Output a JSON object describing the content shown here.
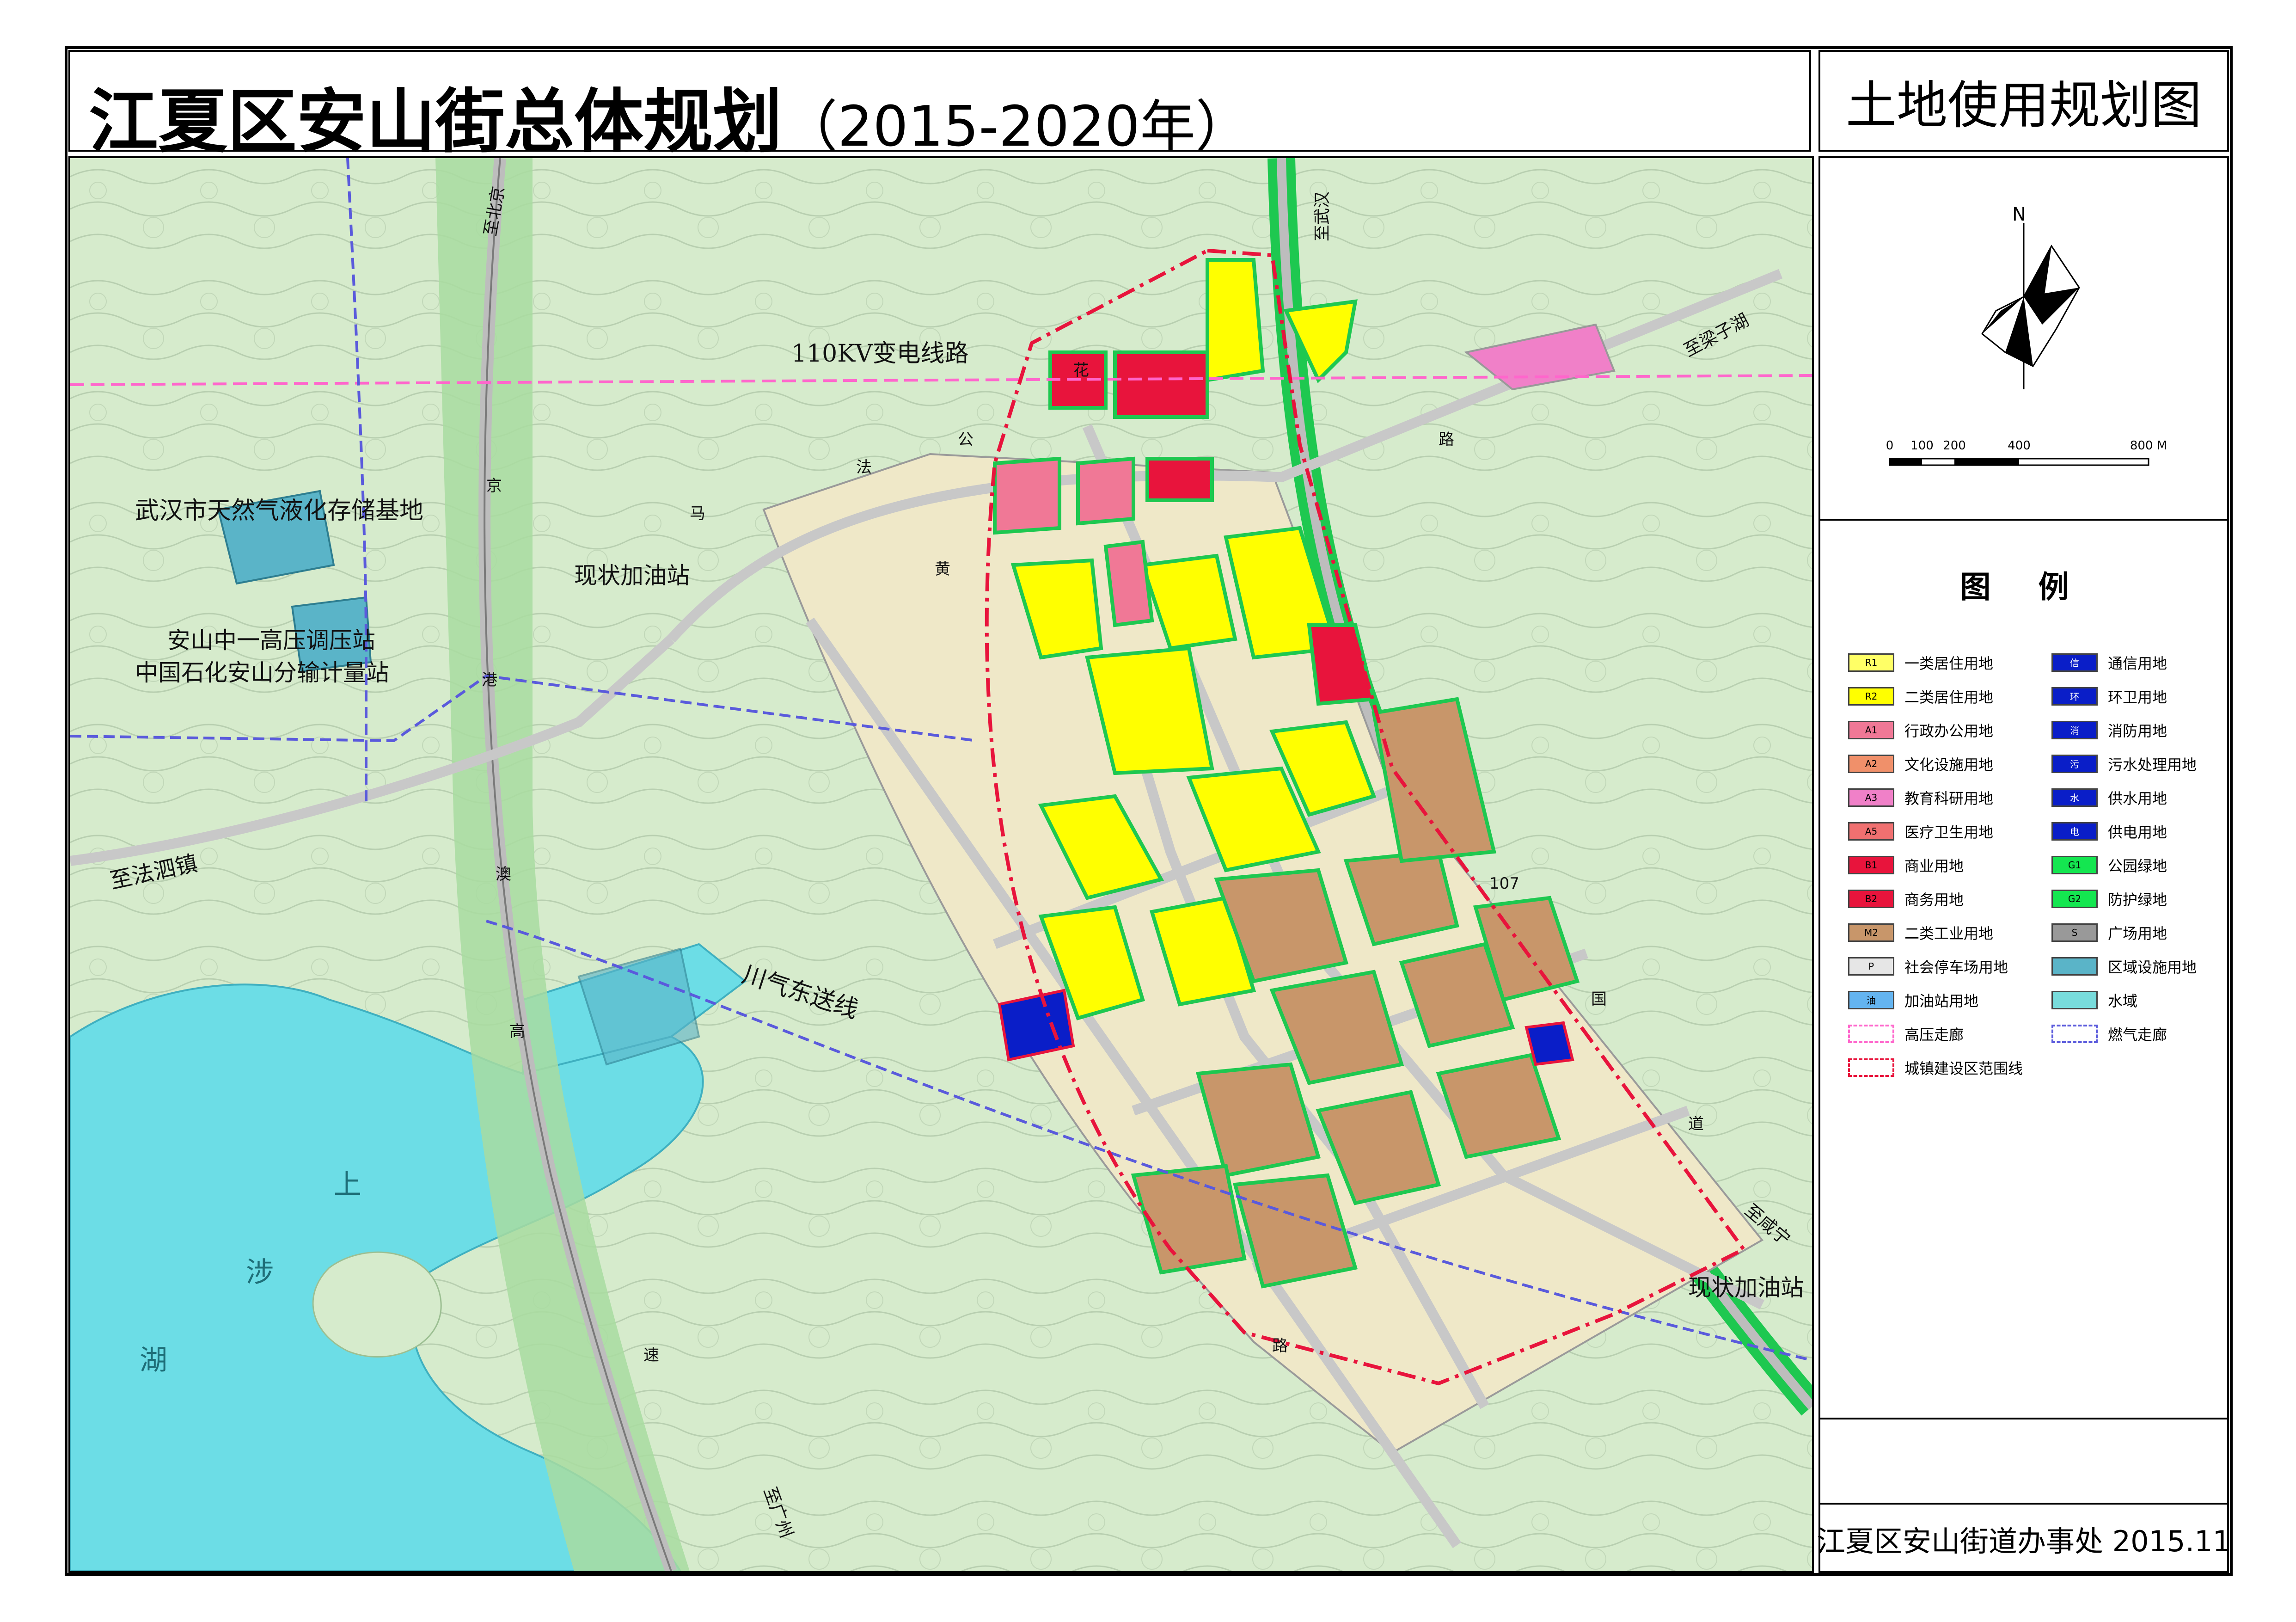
{
  "title": {
    "main": "江夏区安山街总体规划",
    "years": "（2015-2020年）",
    "subtitle": "土地使用规划图"
  },
  "compass": {
    "north_label": "N"
  },
  "scale_bar": {
    "ticks": [
      "0",
      "100",
      "200",
      "400",
      "800 M"
    ]
  },
  "legend": {
    "title": "图 例",
    "left": [
      {
        "label": "一类居住用地",
        "code": "R1",
        "color": "#ffff66"
      },
      {
        "label": "二类居住用地",
        "code": "R2",
        "color": "#ffff00"
      },
      {
        "label": "行政办公用地",
        "code": "A1",
        "color": "#f07896"
      },
      {
        "label": "文化设施用地",
        "code": "A2",
        "color": "#f0906a"
      },
      {
        "label": "教育科研用地",
        "code": "A3",
        "color": "#f080c8"
      },
      {
        "label": "医疗卫生用地",
        "code": "A5",
        "color": "#f07070"
      },
      {
        "label": "商业用地",
        "code": "B1",
        "color": "#e8143c"
      },
      {
        "label": "商务用地",
        "code": "B2",
        "color": "#e8143c"
      },
      {
        "label": "二类工业用地",
        "code": "M2",
        "color": "#c8966a"
      },
      {
        "label": "社会停车场用地",
        "code": "P",
        "color": "#e6e6e6"
      },
      {
        "label": "加油站用地",
        "code": "油",
        "color": "#64b4f0"
      },
      {
        "label": "高压走廊",
        "code": "",
        "color": "#ff66cc"
      },
      {
        "label": "城镇建设区范围线",
        "code": "",
        "color": "#e8143c"
      }
    ],
    "right": [
      {
        "label": "通信用地",
        "code": "信",
        "color": "#0a1ec8"
      },
      {
        "label": "环卫用地",
        "code": "环",
        "color": "#0a1ec8"
      },
      {
        "label": "消防用地",
        "code": "消",
        "color": "#0a1ec8"
      },
      {
        "label": "污水处理用地",
        "code": "污",
        "color": "#0a1ec8"
      },
      {
        "label": "供水用地",
        "code": "水",
        "color": "#0a1ec8"
      },
      {
        "label": "供电用地",
        "code": "电",
        "color": "#0a1ec8"
      },
      {
        "label": "公园绿地",
        "code": "G1",
        "color": "#14e650"
      },
      {
        "label": "防护绿地",
        "code": "G2",
        "color": "#14e650"
      },
      {
        "label": "广场用地",
        "code": "S",
        "color": "#999999"
      },
      {
        "label": "区域设施用地",
        "code": "",
        "color": "#5ab4c8"
      },
      {
        "label": "水域",
        "code": "",
        "color": "#78dcdc"
      },
      {
        "label": "燃气走廊",
        "code": "",
        "color": "#5a5adc"
      }
    ]
  },
  "map_labels": {
    "power_line": "110KV变电线路",
    "lng_base": "武汉市天然气液化存储基地",
    "pressure_station": "安山中一高压调压站",
    "metering_station": "中国石化安山分输计量站",
    "gas_station_1": "现状加油站",
    "gas_station_2": "现状加油站",
    "to_fasi": "至法泗镇",
    "gas_pipeline": "川气东送线",
    "to_beijing": "至北京",
    "to_wuhan": "至武汉",
    "to_liangzihu": "至梁子湖",
    "to_guangzhou": "至广州",
    "to_xianning": "至咸宁",
    "jinggang_chars": [
      "京",
      "港",
      "澳",
      "高",
      "速"
    ],
    "huafagong_chars": [
      "花",
      "法",
      "公",
      "路"
    ],
    "guodao_chars": [
      "107",
      "国",
      "道"
    ],
    "lake_chars": [
      "上",
      "涉",
      "湖"
    ],
    "mahuang_chars": [
      "马",
      "黄",
      "路"
    ]
  },
  "footer": "江夏区安山街道办事处  2015.11"
}
